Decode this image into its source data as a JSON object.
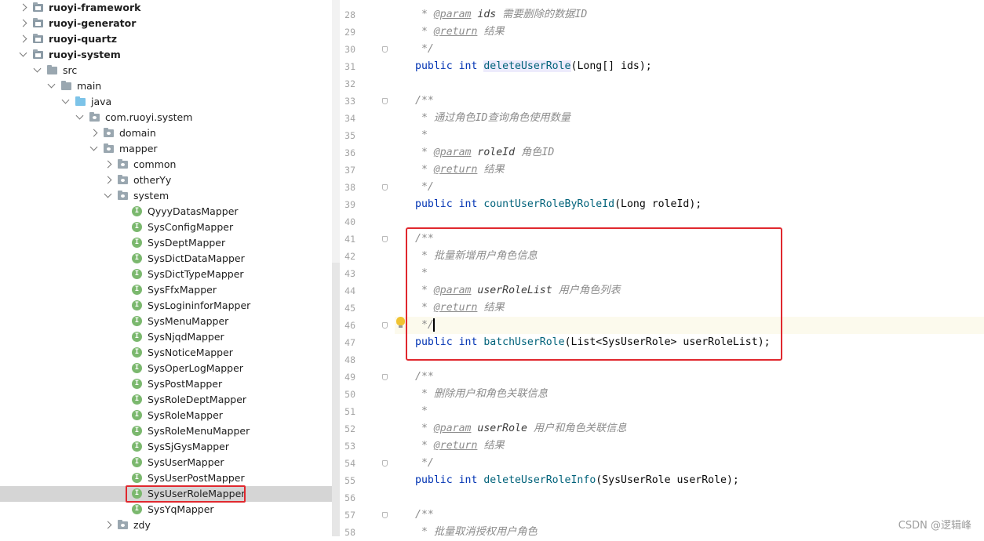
{
  "project_tree": {
    "rows": [
      {
        "label": "ruoyi-framework",
        "expanded": false,
        "icon": "module-folder-icon",
        "bold": true
      },
      {
        "label": "ruoyi-generator",
        "expanded": false,
        "icon": "module-folder-icon",
        "bold": true
      },
      {
        "label": "ruoyi-quartz",
        "expanded": false,
        "icon": "module-folder-icon",
        "bold": true
      },
      {
        "label": "ruoyi-system",
        "expanded": true,
        "icon": "module-folder-icon",
        "bold": true
      },
      {
        "label": "src",
        "expanded": true,
        "icon": "folder-icon"
      },
      {
        "label": "main",
        "expanded": true,
        "icon": "folder-icon"
      },
      {
        "label": "java",
        "expanded": true,
        "icon": "source-folder-icon"
      },
      {
        "label": "com.ruoyi.system",
        "expanded": true,
        "icon": "package-icon"
      },
      {
        "label": "domain",
        "expanded": false,
        "icon": "package-icon"
      },
      {
        "label": "mapper",
        "expanded": true,
        "icon": "package-icon"
      },
      {
        "label": "common",
        "expanded": false,
        "icon": "package-icon"
      },
      {
        "label": "otherYy",
        "expanded": false,
        "icon": "package-icon"
      },
      {
        "label": "system",
        "expanded": true,
        "icon": "package-icon"
      },
      {
        "label": "QyyyDatasMapper",
        "icon": "interface-icon"
      },
      {
        "label": "SysConfigMapper",
        "icon": "interface-icon"
      },
      {
        "label": "SysDeptMapper",
        "icon": "interface-icon"
      },
      {
        "label": "SysDictDataMapper",
        "icon": "interface-icon"
      },
      {
        "label": "SysDictTypeMapper",
        "icon": "interface-icon"
      },
      {
        "label": "SysFfxMapper",
        "icon": "interface-icon"
      },
      {
        "label": "SysLogininforMapper",
        "icon": "interface-icon"
      },
      {
        "label": "SysMenuMapper",
        "icon": "interface-icon"
      },
      {
        "label": "SysNjqdMapper",
        "icon": "interface-icon"
      },
      {
        "label": "SysNoticeMapper",
        "icon": "interface-icon"
      },
      {
        "label": "SysOperLogMapper",
        "icon": "interface-icon"
      },
      {
        "label": "SysPostMapper",
        "icon": "interface-icon"
      },
      {
        "label": "SysRoleDeptMapper",
        "icon": "interface-icon"
      },
      {
        "label": "SysRoleMapper",
        "icon": "interface-icon"
      },
      {
        "label": "SysRoleMenuMapper",
        "icon": "interface-icon"
      },
      {
        "label": "SysSjGysMapper",
        "icon": "interface-icon"
      },
      {
        "label": "SysUserMapper",
        "icon": "interface-icon"
      },
      {
        "label": "SysUserPostMapper",
        "icon": "interface-icon"
      },
      {
        "label": "SysUserRoleMapper",
        "icon": "interface-icon",
        "selected": true
      },
      {
        "label": "SysYqMapper",
        "icon": "interface-icon"
      },
      {
        "label": "zdy",
        "expanded": false,
        "icon": "package-icon"
      }
    ]
  },
  "editor": {
    "lines": [
      {
        "num": "28",
        "tokens": [
          [
            "c-comment",
            " * "
          ],
          [
            "c-tag",
            "@param"
          ],
          [
            "c-param",
            " ids "
          ],
          [
            "c-comment",
            "需要删除的数据ID"
          ]
        ]
      },
      {
        "num": "29",
        "tokens": [
          [
            "c-comment",
            " * "
          ],
          [
            "c-tag",
            "@return"
          ],
          [
            "c-comment",
            " 结果"
          ]
        ]
      },
      {
        "num": "30",
        "tokens": [
          [
            "c-comment",
            " */"
          ]
        ],
        "fold": true
      },
      {
        "num": "31",
        "tokens": [
          [
            "c-kw",
            "public "
          ],
          [
            "c-kw",
            "int "
          ],
          [
            "c-method-hl",
            "deleteUserRole"
          ],
          [
            "c-plain",
            "(Long[] ids);"
          ]
        ]
      },
      {
        "num": "32",
        "tokens": []
      },
      {
        "num": "33",
        "tokens": [
          [
            "c-comment",
            "/**"
          ]
        ],
        "fold": true
      },
      {
        "num": "34",
        "tokens": [
          [
            "c-comment",
            " * 通过角色ID查询角色使用数量"
          ]
        ]
      },
      {
        "num": "35",
        "tokens": [
          [
            "c-comment",
            " *"
          ]
        ]
      },
      {
        "num": "36",
        "tokens": [
          [
            "c-comment",
            " * "
          ],
          [
            "c-tag",
            "@param"
          ],
          [
            "c-param",
            " roleId "
          ],
          [
            "c-comment",
            "角色ID"
          ]
        ]
      },
      {
        "num": "37",
        "tokens": [
          [
            "c-comment",
            " * "
          ],
          [
            "c-tag",
            "@return"
          ],
          [
            "c-comment",
            " 结果"
          ]
        ]
      },
      {
        "num": "38",
        "tokens": [
          [
            "c-comment",
            " */"
          ]
        ],
        "fold": true
      },
      {
        "num": "39",
        "tokens": [
          [
            "c-kw",
            "public "
          ],
          [
            "c-kw",
            "int "
          ],
          [
            "c-method",
            "countUserRoleByRoleId"
          ],
          [
            "c-plain",
            "(Long roleId);"
          ]
        ]
      },
      {
        "num": "40",
        "tokens": []
      },
      {
        "num": "41",
        "tokens": [
          [
            "c-comment",
            "/**"
          ]
        ],
        "fold": true
      },
      {
        "num": "42",
        "tokens": [
          [
            "c-comment",
            " * 批量新增用户角色信息"
          ]
        ]
      },
      {
        "num": "43",
        "tokens": [
          [
            "c-comment",
            " *"
          ]
        ]
      },
      {
        "num": "44",
        "tokens": [
          [
            "c-comment",
            " * "
          ],
          [
            "c-tag",
            "@param"
          ],
          [
            "c-param",
            " userRoleList "
          ],
          [
            "c-comment",
            "用户角色列表"
          ]
        ]
      },
      {
        "num": "45",
        "tokens": [
          [
            "c-comment",
            " * "
          ],
          [
            "c-tag",
            "@return"
          ],
          [
            "c-comment",
            " 结果"
          ]
        ]
      },
      {
        "num": "46",
        "tokens": [
          [
            "c-comment",
            " */"
          ]
        ],
        "fold": true,
        "current": true
      },
      {
        "num": "47",
        "tokens": [
          [
            "c-kw",
            "public "
          ],
          [
            "c-kw",
            "int "
          ],
          [
            "c-method",
            "batchUserRole"
          ],
          [
            "c-plain",
            "(List<SysUserRole> userRoleList);"
          ]
        ]
      },
      {
        "num": "48",
        "tokens": []
      },
      {
        "num": "49",
        "tokens": [
          [
            "c-comment",
            "/**"
          ]
        ],
        "fold": true
      },
      {
        "num": "50",
        "tokens": [
          [
            "c-comment",
            " * 删除用户和角色关联信息"
          ]
        ]
      },
      {
        "num": "51",
        "tokens": [
          [
            "c-comment",
            " *"
          ]
        ]
      },
      {
        "num": "52",
        "tokens": [
          [
            "c-comment",
            " * "
          ],
          [
            "c-tag",
            "@param"
          ],
          [
            "c-param",
            " userRole "
          ],
          [
            "c-comment",
            "用户和角色关联信息"
          ]
        ]
      },
      {
        "num": "53",
        "tokens": [
          [
            "c-comment",
            " * "
          ],
          [
            "c-tag",
            "@return"
          ],
          [
            "c-comment",
            " 结果"
          ]
        ]
      },
      {
        "num": "54",
        "tokens": [
          [
            "c-comment",
            " */"
          ]
        ],
        "fold": true
      },
      {
        "num": "55",
        "tokens": [
          [
            "c-kw",
            "public "
          ],
          [
            "c-kw",
            "int "
          ],
          [
            "c-method",
            "deleteUserRoleInfo"
          ],
          [
            "c-plain",
            "(SysUserRole userRole);"
          ]
        ]
      },
      {
        "num": "56",
        "tokens": []
      },
      {
        "num": "57",
        "tokens": [
          [
            "c-comment",
            "/**"
          ]
        ],
        "fold": true
      },
      {
        "num": "58",
        "tokens": [
          [
            "c-comment",
            " * 批量取消授权用户角色"
          ]
        ]
      }
    ]
  },
  "watermark": "CSDN @逻辑峰"
}
